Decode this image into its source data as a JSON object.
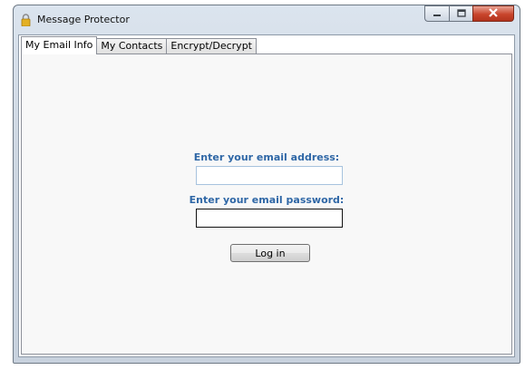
{
  "window": {
    "title": "Message Protector"
  },
  "tabs": [
    {
      "label": "My Email Info",
      "active": true
    },
    {
      "label": "My Contacts",
      "active": false
    },
    {
      "label": "Encrypt/Decrypt",
      "active": false
    }
  ],
  "form": {
    "email_label": "Enter your email address:",
    "email_value": "",
    "password_label": "Enter your email password:",
    "password_value": "",
    "login_label": "Log in"
  },
  "colors": {
    "label_text": "#2f67a6",
    "close_button": "#c9452c"
  },
  "icons": {
    "app": "lock-icon",
    "minimize": "minimize-icon",
    "maximize": "maximize-icon",
    "close": "close-icon"
  }
}
